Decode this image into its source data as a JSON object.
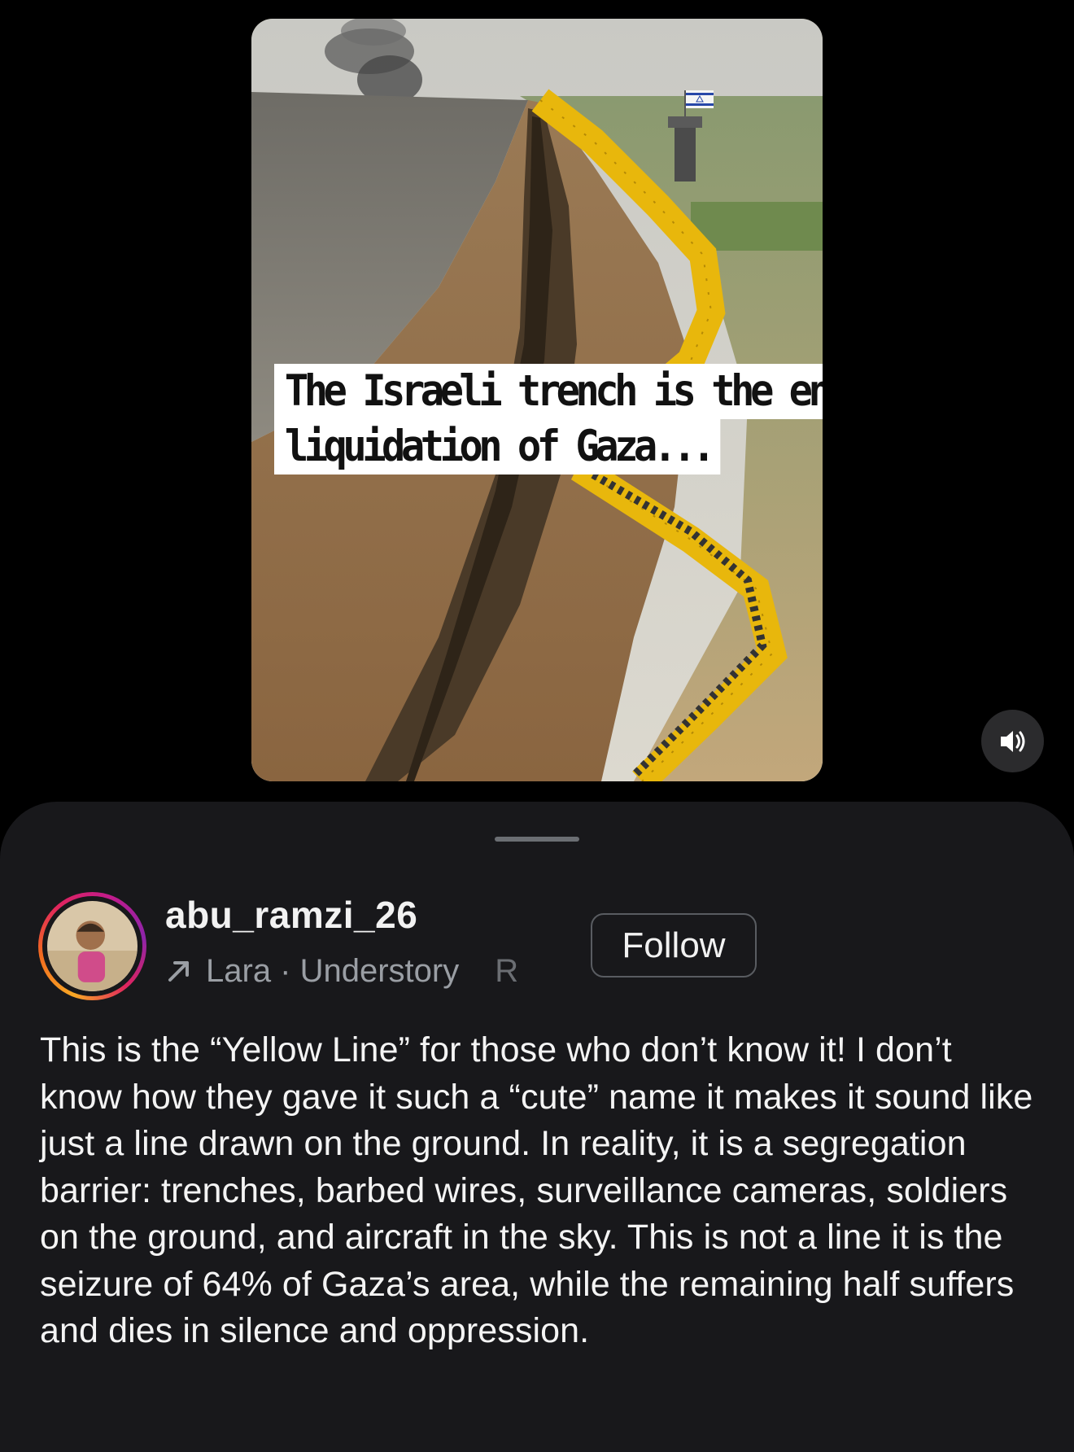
{
  "media": {
    "overlay_line_1": "The Israeli trench is the end and",
    "overlay_line_2": "liquidation of Gaza...",
    "sound_icon": "speaker-volume-icon"
  },
  "post": {
    "username": "abu_ramzi_26",
    "music_icon": "arrow-up-right-icon",
    "music_label": "Lara · Understory",
    "music_overflow": "R",
    "follow_label": "Follow",
    "caption": "This is the “Yellow Line” for those who don’t know it! I don’t know how they gave it such a “cute” name it makes it sound like just a line drawn on the ground. In reality, it is a segregation barrier: trenches, barbed wires, surveillance cameras, soldiers on the ground, and aircraft in the sky. This is not a line it is the seizure of 64% of Gaza’s area, while the remaining half suffers and dies in silence and oppression."
  },
  "colors": {
    "background": "#000000",
    "sheet": "#18181b",
    "muted_text": "#9a9ea4",
    "fence_yellow": "#e8b70c"
  }
}
